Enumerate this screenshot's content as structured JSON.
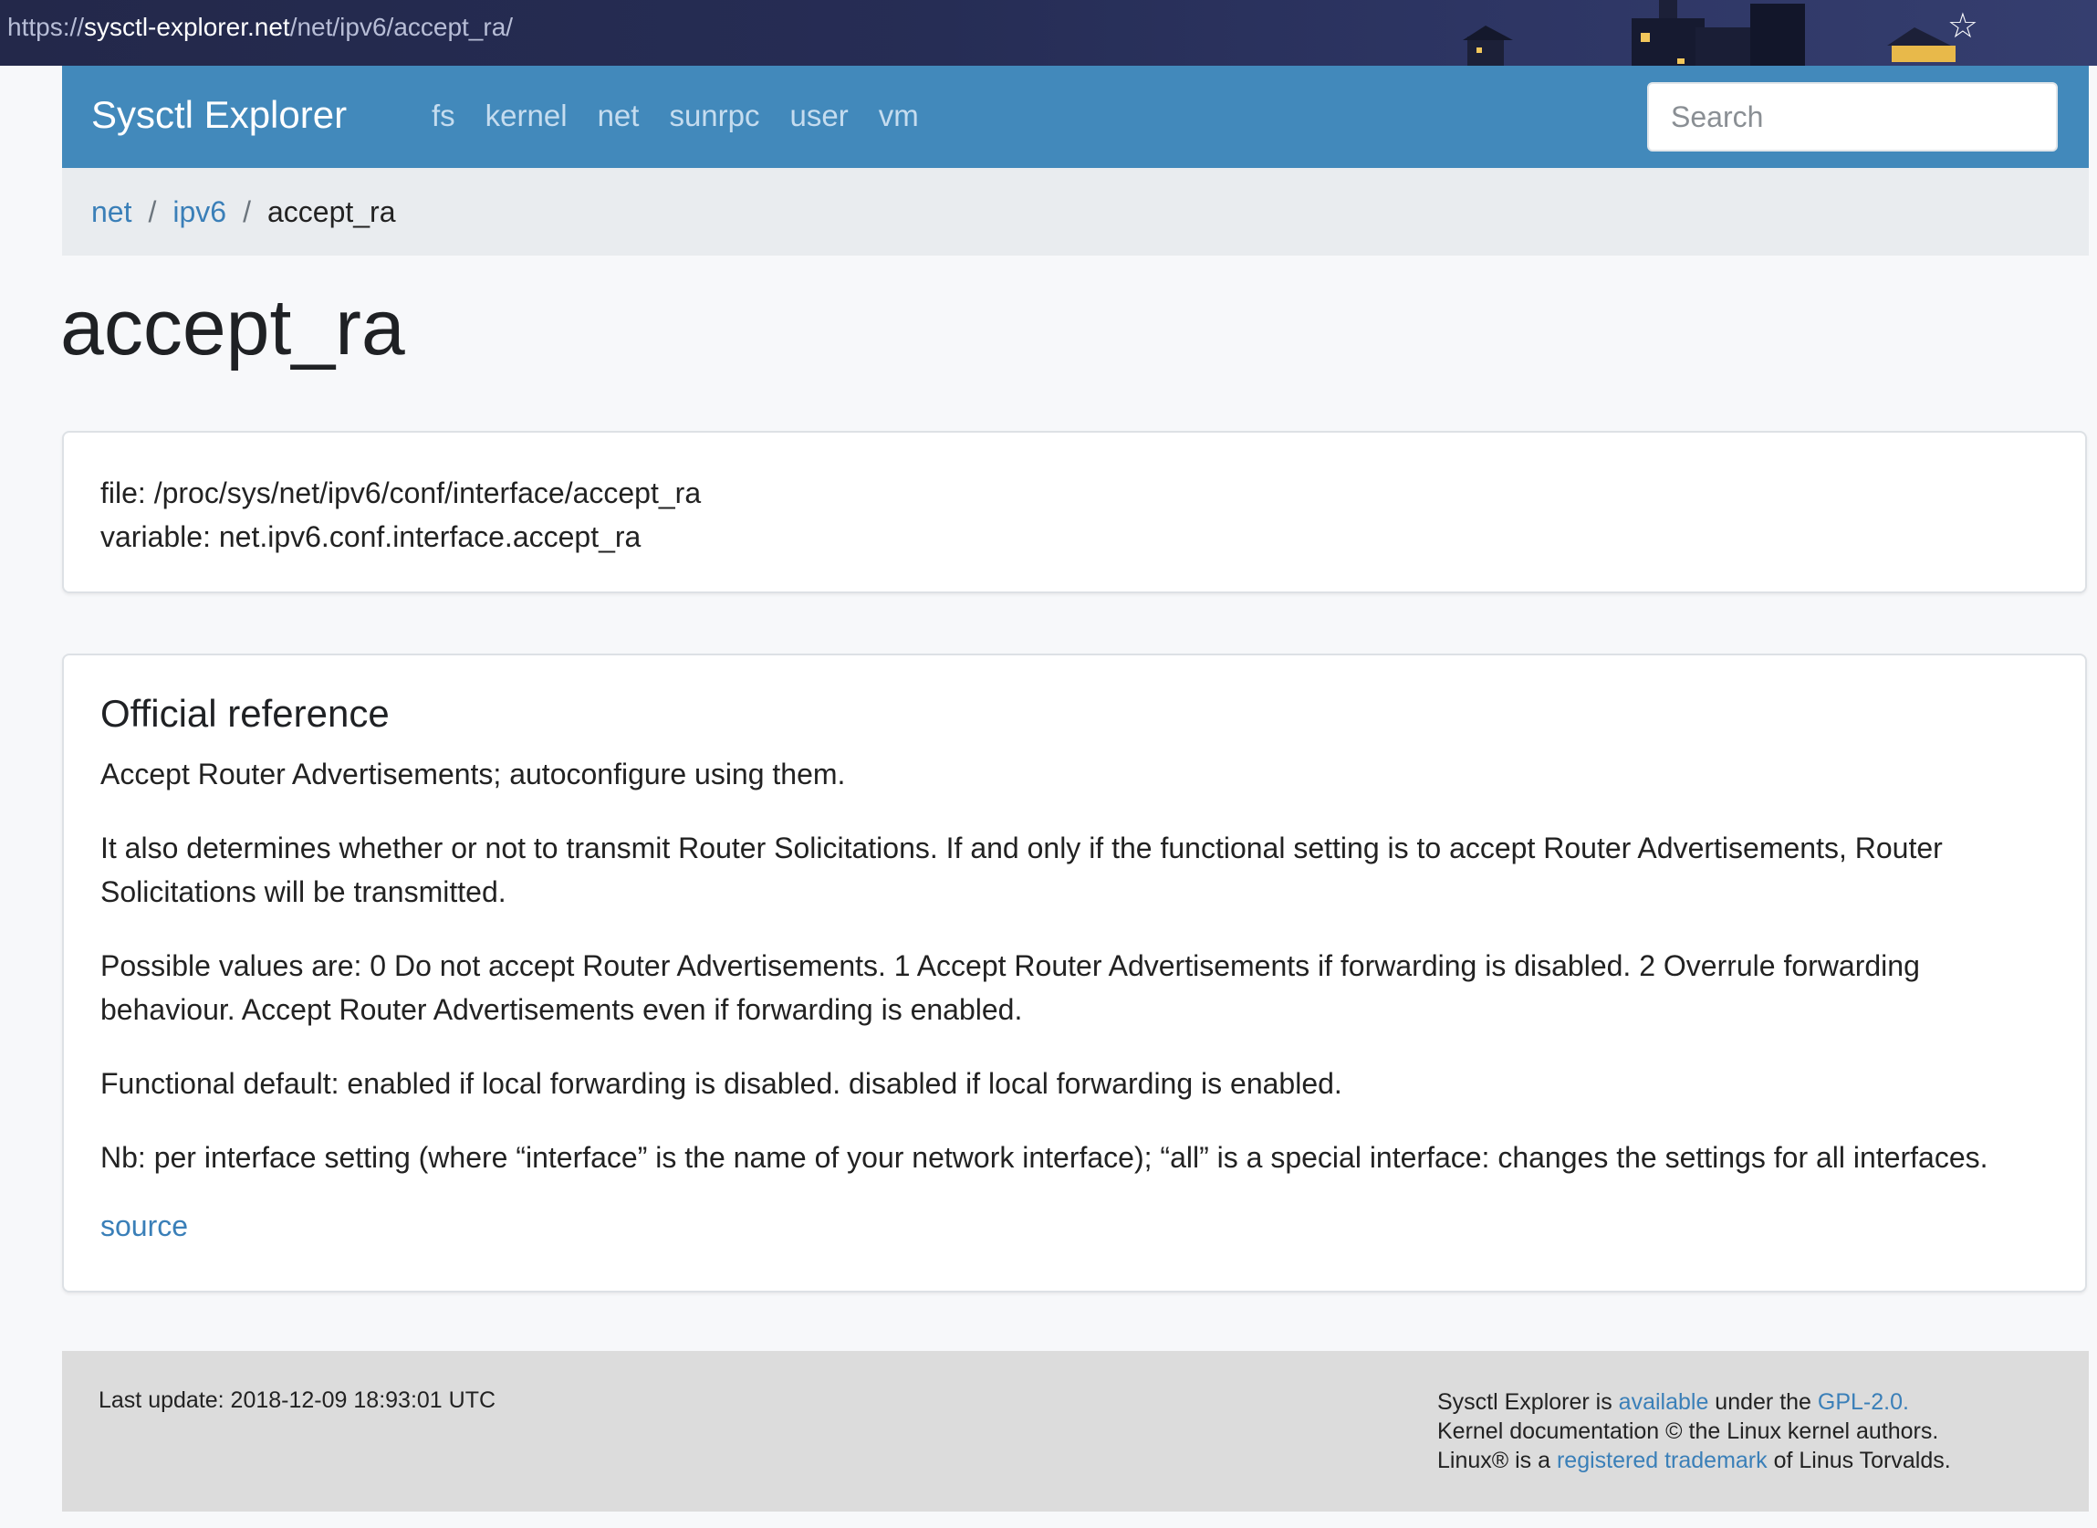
{
  "browser": {
    "url_scheme": "https://",
    "url_host": "sysctl-explorer.net",
    "url_path": "/net/ipv6/accept_ra/"
  },
  "navbar": {
    "brand": "Sysctl Explorer",
    "links": [
      "fs",
      "kernel",
      "net",
      "sunrpc",
      "user",
      "vm"
    ],
    "search_placeholder": "Search"
  },
  "breadcrumb": {
    "items": [
      "net",
      "ipv6"
    ],
    "current": "accept_ra"
  },
  "page": {
    "title": "accept_ra",
    "file_line": "file: /proc/sys/net/ipv6/conf/interface/accept_ra",
    "variable_line": "variable: net.ipv6.conf.interface.accept_ra"
  },
  "reference": {
    "heading": "Official reference",
    "paragraphs": [
      "Accept Router Advertisements; autoconfigure using them.",
      "It also determines whether or not to transmit Router Solicitations. If and only if the functional setting is to accept Router Advertisements, Router Solicitations will be transmitted.",
      "Possible values are: 0 Do not accept Router Advertisements. 1 Accept Router Advertisements if forwarding is disabled. 2 Overrule forwarding behaviour. Accept Router Advertisements even if forwarding is enabled.",
      "Functional default: enabled if local forwarding is disabled. disabled if local forwarding is enabled.",
      "Nb: per interface setting (where “interface” is the name of your network interface); “all” is a special interface: changes the settings for all interfaces."
    ],
    "source_link": "source"
  },
  "footer": {
    "last_update": "Last update: 2018-12-09 18:93:01 UTC",
    "line1_a": "Sysctl Explorer is ",
    "line1_link1": "available",
    "line1_b": " under the ",
    "line1_link2": "GPL-2.0.",
    "line2": "Kernel documentation © the Linux kernel authors.",
    "line3_a": "Linux® is a ",
    "line3_link": "registered trademark",
    "line3_b": " of Linus Torvalds."
  },
  "colors": {
    "navbar": "#4289bb",
    "link": "#3a7fb8",
    "breadcrumb_bg": "#e9ecef",
    "footer_bg": "#dcdcdc"
  }
}
